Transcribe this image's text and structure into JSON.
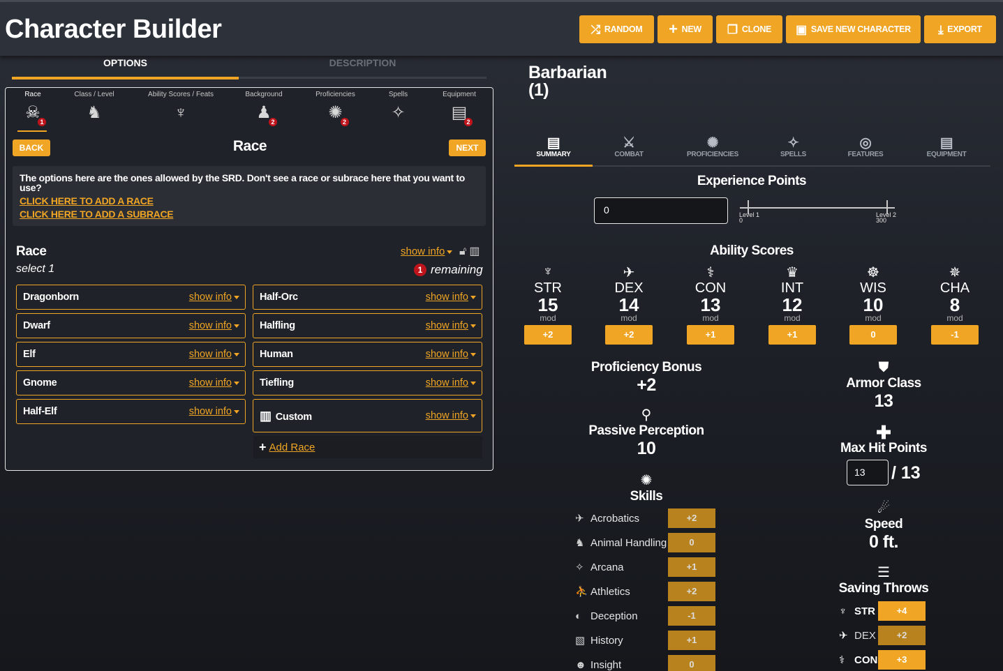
{
  "header": {
    "title": "Character Builder",
    "buttons": [
      {
        "label": "RANDOM",
        "icon": "shuffle-icon"
      },
      {
        "label": "NEW",
        "icon": "plus-icon"
      },
      {
        "label": "CLONE",
        "icon": "clone-icon"
      },
      {
        "label": "SAVE NEW CHARACTER",
        "icon": "floppy-icon"
      },
      {
        "label": "EXPORT",
        "icon": "download-icon"
      }
    ]
  },
  "left_tabs": {
    "options": "OPTIONS",
    "description": "DESCRIPTION"
  },
  "steps": [
    {
      "label": "Race",
      "badge": "1"
    },
    {
      "label": "Class / Level",
      "badge": ""
    },
    {
      "label": "Ability Scores / Feats",
      "badge": ""
    },
    {
      "label": "Background",
      "badge": "2"
    },
    {
      "label": "Proficiencies",
      "badge": "2"
    },
    {
      "label": "Spells",
      "badge": ""
    },
    {
      "label": "Equipment",
      "badge": "2"
    }
  ],
  "race_step": {
    "back": "BACK",
    "next": "NEXT",
    "heading": "Race",
    "notice": "The options here are the ones allowed by the SRD. Don't see a race or subrace here that you want to use?",
    "link_race": "CLICK HERE TO ADD A RACE",
    "link_subrace": "CLICK HERE TO ADD A SUBRACE",
    "section_title": "Race",
    "select": "select 1",
    "show_info": "show info",
    "remaining_count": "1",
    "remaining": "remaining",
    "left_options": [
      "Dragonborn",
      "Dwarf",
      "Elf",
      "Gnome",
      "Half-Elf"
    ],
    "right_options": [
      "Half-Orc",
      "Halfling",
      "Human",
      "Tiefling",
      "Custom"
    ],
    "add_race": "Add Race"
  },
  "character": {
    "class_name": "Barbarian",
    "level": "(1)"
  },
  "right_tabs": [
    "SUMMARY",
    "COMBAT",
    "PROFICIENCIES",
    "SPELLS",
    "FEATURES",
    "EQUIPMENT"
  ],
  "xp": {
    "title": "Experience Points",
    "value": "0",
    "level1": "Level 1",
    "level1_xp": "0",
    "level2": "Level 2",
    "level2_xp": "300"
  },
  "abilities": {
    "title": "Ability Scores",
    "mod_label": "mod",
    "items": [
      {
        "name": "STR",
        "score": "15",
        "mod": "+2"
      },
      {
        "name": "DEX",
        "score": "14",
        "mod": "+2"
      },
      {
        "name": "CON",
        "score": "13",
        "mod": "+1"
      },
      {
        "name": "INT",
        "score": "12",
        "mod": "+1"
      },
      {
        "name": "WIS",
        "score": "10",
        "mod": "0"
      },
      {
        "name": "CHA",
        "score": "8",
        "mod": "-1"
      }
    ]
  },
  "stats": {
    "prof_label": "Proficiency Bonus",
    "prof_value": "+2",
    "pp_label": "Passive Perception",
    "pp_value": "10",
    "ac_label": "Armor Class",
    "ac_value": "13",
    "hp_label": "Max Hit Points",
    "hp_current": "13",
    "hp_max": "/ 13",
    "speed_label": "Speed",
    "speed_value": "0 ft."
  },
  "skills": {
    "title": "Skills",
    "items": [
      {
        "name": "Acrobatics",
        "value": "+2"
      },
      {
        "name": "Animal Handling",
        "value": "0"
      },
      {
        "name": "Arcana",
        "value": "+1"
      },
      {
        "name": "Athletics",
        "value": "+2"
      },
      {
        "name": "Deception",
        "value": "-1"
      },
      {
        "name": "History",
        "value": "+1"
      },
      {
        "name": "Insight",
        "value": "0"
      }
    ]
  },
  "saves": {
    "title": "Saving Throws",
    "items": [
      {
        "name": "STR",
        "value": "+4",
        "color": "#f0a524"
      },
      {
        "name": "DEX",
        "value": "+2",
        "color": "#b8821e"
      },
      {
        "name": "CON",
        "value": "+3",
        "color": "#f0a524"
      }
    ]
  },
  "colors": {
    "accent": "#f0a524",
    "badge": "#c0141c",
    "dim_accent": "#b8821e"
  }
}
